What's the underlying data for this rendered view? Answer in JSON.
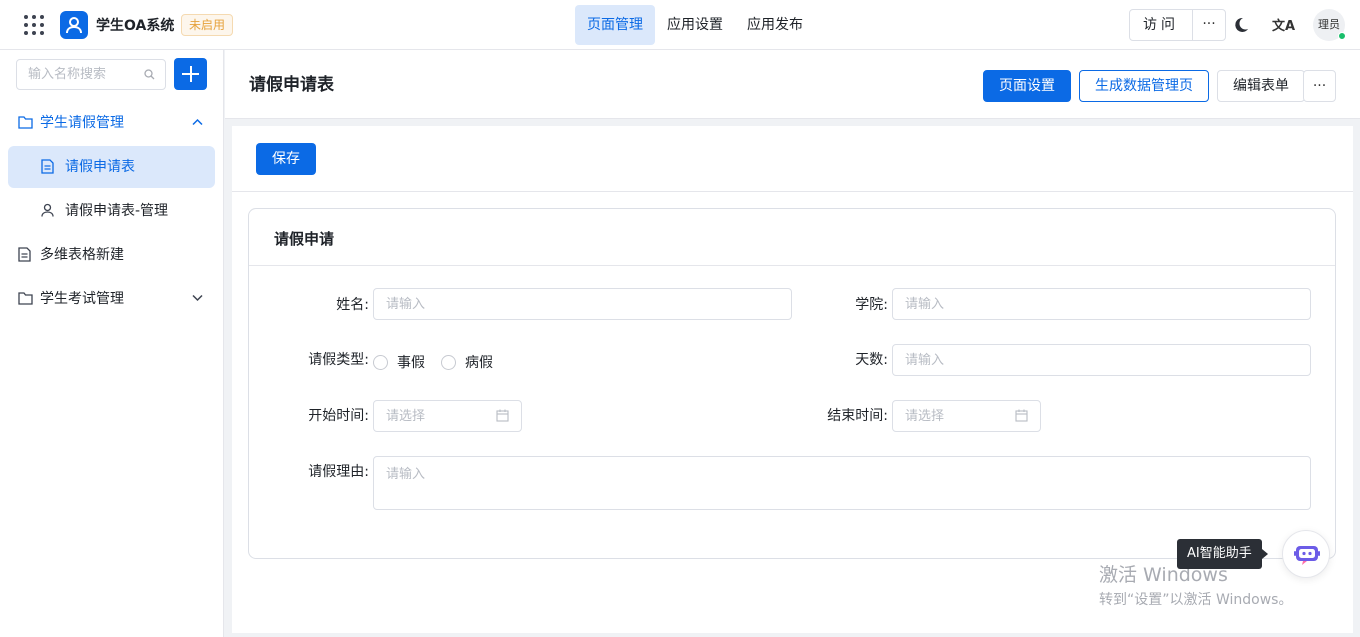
{
  "header": {
    "app_title": "学生OA系统",
    "status_badge": "未启用",
    "nav": [
      {
        "label": "页面管理",
        "active": true
      },
      {
        "label": "应用设置",
        "active": false
      },
      {
        "label": "应用发布",
        "active": false
      }
    ],
    "visit_label": "访问",
    "more_label": "···",
    "translate_label": "文A",
    "avatar_text": "理员"
  },
  "sidebar": {
    "search_placeholder": "输入名称搜索",
    "items": [
      {
        "label": "学生请假管理",
        "type": "folder",
        "expanded": true
      },
      {
        "label": "请假申请表",
        "type": "form",
        "selected": true
      },
      {
        "label": "请假申请表-管理",
        "type": "user"
      },
      {
        "label": "多维表格新建",
        "type": "doc"
      },
      {
        "label": "学生考试管理",
        "type": "folder",
        "expanded": false
      }
    ]
  },
  "main": {
    "page_title": "请假申请表",
    "buttons": {
      "page_settings": "页面设置",
      "generate_admin": "生成数据管理页",
      "edit_form": "编辑表单",
      "more": "···"
    },
    "save_label": "保存",
    "form": {
      "title": "请假申请",
      "fields": {
        "name": {
          "label": "姓名:",
          "placeholder": "请输入"
        },
        "college": {
          "label": "学院:",
          "placeholder": "请输入"
        },
        "leave_type": {
          "label": "请假类型:",
          "options": [
            "事假",
            "病假"
          ]
        },
        "days": {
          "label": "天数:",
          "placeholder": "请输入"
        },
        "start_time": {
          "label": "开始时间:",
          "placeholder": "请选择"
        },
        "end_time": {
          "label": "结束时间:",
          "placeholder": "请选择"
        },
        "reason": {
          "label": "请假理由:",
          "placeholder": "请输入"
        }
      }
    }
  },
  "ai_assistant": {
    "tooltip": "AI智能助手"
  },
  "watermark": {
    "line1": "激活 Windows",
    "line2": "转到“设置”以激活 Windows。"
  },
  "colors": {
    "primary": "#0b6ae5",
    "badge_text": "#e6a23c",
    "online": "#19be6b"
  }
}
